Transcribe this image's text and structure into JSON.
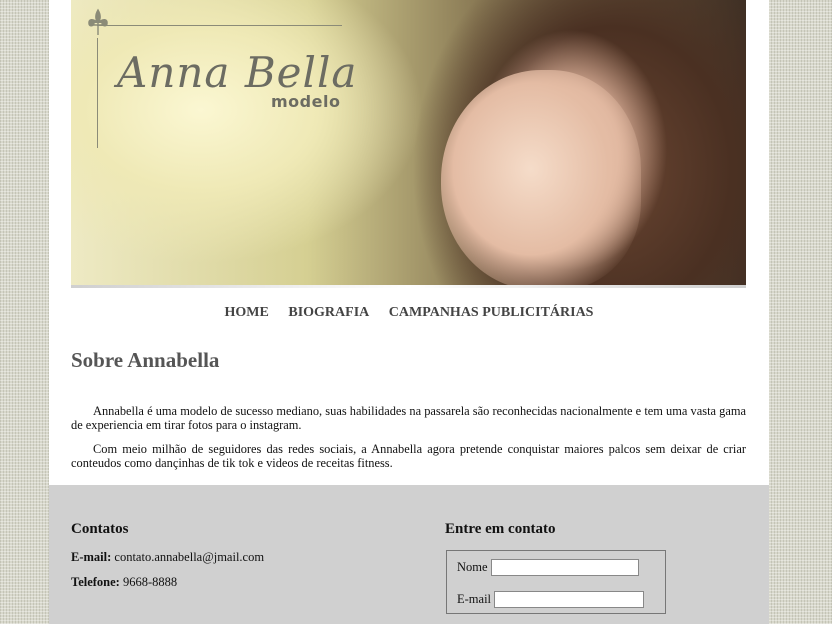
{
  "header": {
    "logo_script": "Anna Bella",
    "logo_sub": "modelo"
  },
  "nav": {
    "items": [
      "HOME",
      "BIOGRAFIA",
      "CAMPANHAS PUBLICITÁRIAS"
    ]
  },
  "main": {
    "title": "Sobre Annabella",
    "paragraphs": [
      "Annabella é uma modelo de sucesso mediano, suas habilidades na passarela são reconhecidas nacionalmente e tem uma vasta gama de experiencia em tirar fotos para o instagram.",
      "Com meio milhão de seguidores das redes sociais, a Annabella agora pretende conquistar maiores palcos sem deixar de criar conteudos como dançinhas de tik tok e videos de receitas fitness."
    ]
  },
  "footer": {
    "contacts_title": "Contatos",
    "email_label": "E-mail:",
    "email_value": "contato.annabella@jmail.com",
    "phone_label": "Telefone:",
    "phone_value": "9668-8888",
    "form_title": "Entre em contato",
    "name_label": "Nome",
    "email_field_label": "E-mail",
    "name_value": "",
    "email_value_input": ""
  },
  "colors": {
    "page_bg": "#d8d8cc",
    "footer_bg": "#d0d0d0",
    "logo_text": "#6c6c62",
    "nav_text": "#444444"
  },
  "icons": [
    "fleur-de-lis-icon"
  ]
}
